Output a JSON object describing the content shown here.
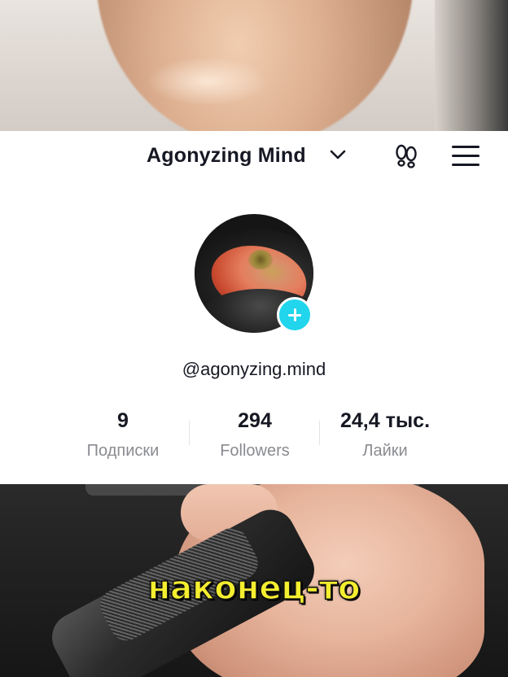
{
  "profile": {
    "display_name": "Agonyzing Mind",
    "handle": "@agonyzing.mind",
    "stats": [
      {
        "value": "9",
        "label": "Подписки"
      },
      {
        "value": "294",
        "label": "Followers"
      },
      {
        "value": "24,4 тыс.",
        "label": "Лайки"
      }
    ]
  },
  "icons": {
    "chevron": "chevron-down-icon",
    "footprint": "footprint-icon",
    "menu": "hamburger-menu-icon",
    "add": "plus-icon"
  },
  "colors": {
    "accent_badge": "#20d5ec",
    "caption": "#f5ee2f",
    "text_primary": "#161823",
    "text_secondary": "#8a8b91"
  },
  "caption": "наконец-то"
}
